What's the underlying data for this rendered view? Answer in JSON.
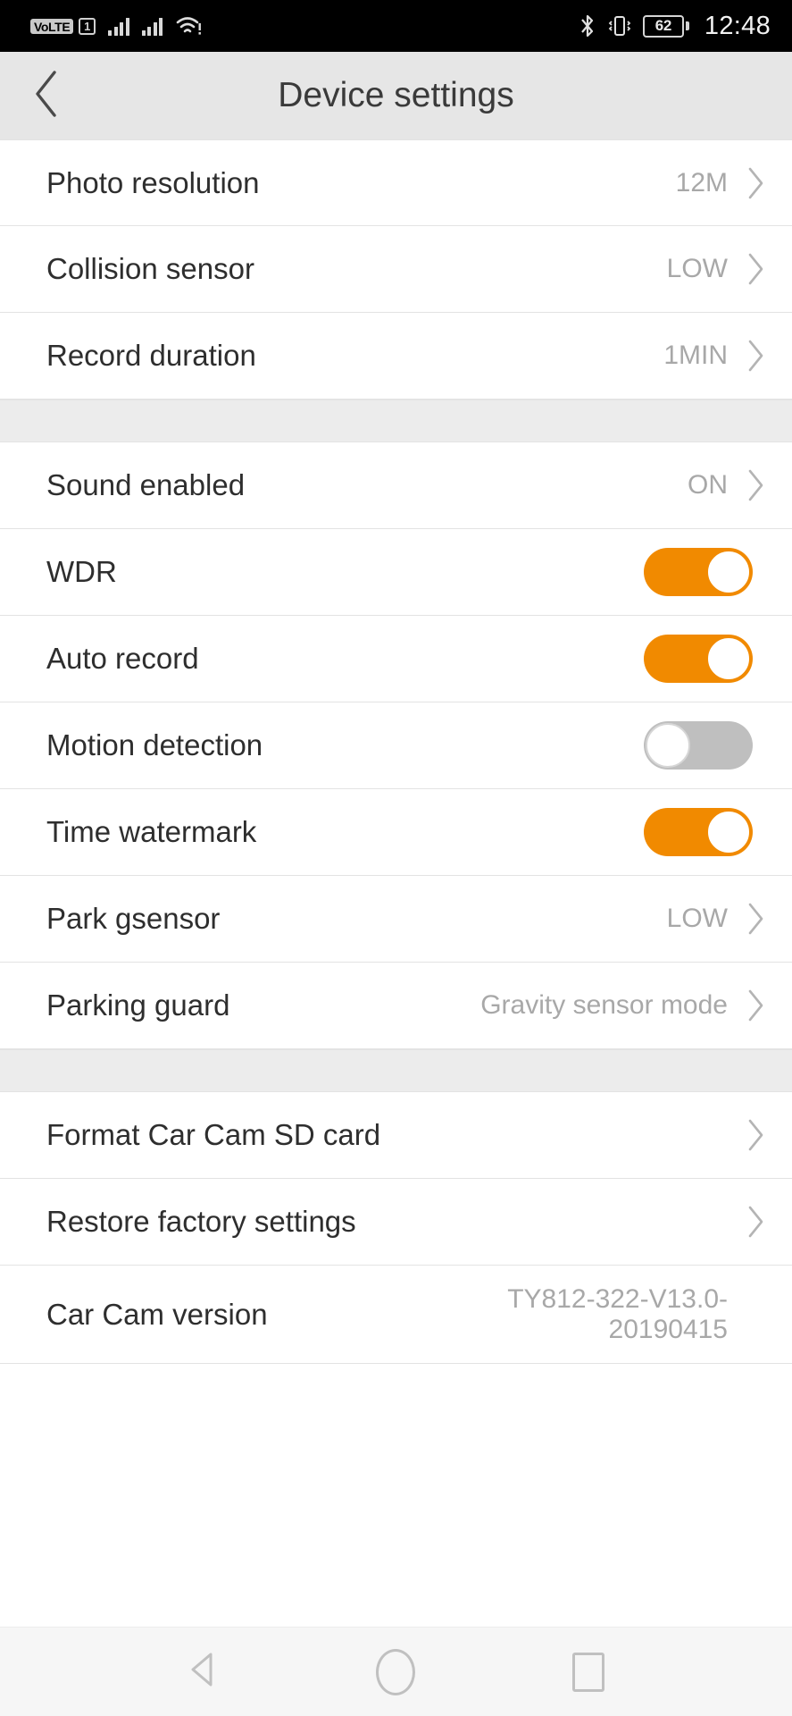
{
  "status_bar": {
    "volte_label": "VoLTE",
    "sim_label": "1",
    "time": "12:48",
    "battery_level": "62",
    "icons": [
      "volte-badge",
      "sim-1-badge",
      "signal-bars-1",
      "signal-bars-2",
      "wifi-icon",
      "bluetooth-icon",
      "vibrate-icon",
      "battery-icon"
    ]
  },
  "header": {
    "title": "Device settings",
    "back_icon": "chevron-left-icon"
  },
  "groups": [
    {
      "id": "capture",
      "rows": [
        {
          "label": "Photo resolution",
          "value": "12M",
          "type": "value",
          "chevron": true
        },
        {
          "label": "Collision sensor",
          "value": "LOW",
          "type": "value",
          "chevron": true
        },
        {
          "label": "Record duration",
          "value": "1MIN",
          "type": "value",
          "chevron": true
        }
      ]
    },
    {
      "id": "recording",
      "rows": [
        {
          "label": "Sound enabled",
          "value": "ON",
          "type": "value",
          "chevron": true
        },
        {
          "label": "WDR",
          "type": "toggle",
          "state": "on"
        },
        {
          "label": "Auto record",
          "type": "toggle",
          "state": "on"
        },
        {
          "label": "Motion detection",
          "type": "toggle",
          "state": "off"
        },
        {
          "label": "Time watermark",
          "type": "toggle",
          "state": "on"
        },
        {
          "label": "Park gsensor",
          "value": "LOW",
          "type": "value",
          "chevron": true
        },
        {
          "label": "Parking guard",
          "value": "Gravity sensor mode",
          "type": "value",
          "chevron": true
        }
      ]
    },
    {
      "id": "maintenance",
      "rows": [
        {
          "label": "Format Car Cam SD card",
          "value": "",
          "type": "action",
          "chevron": true
        },
        {
          "label": "Restore factory settings",
          "value": "",
          "type": "action",
          "chevron": true
        },
        {
          "label": "Car Cam version",
          "value": "TY812-322-V13.0-20190415",
          "type": "info",
          "chevron": false
        }
      ]
    }
  ],
  "nav_bar": {
    "back_icon": "triangle-back-icon",
    "home_icon": "circle-home-icon",
    "recents_icon": "square-recents-icon"
  },
  "colors": {
    "toggle_on": "#F18A00",
    "toggle_off": "#BFBFBF",
    "header_bg": "#E6E6E6",
    "separator_bg": "#ECECEC",
    "value_text": "#A8A8A8",
    "label_text": "#2E2E2E"
  }
}
